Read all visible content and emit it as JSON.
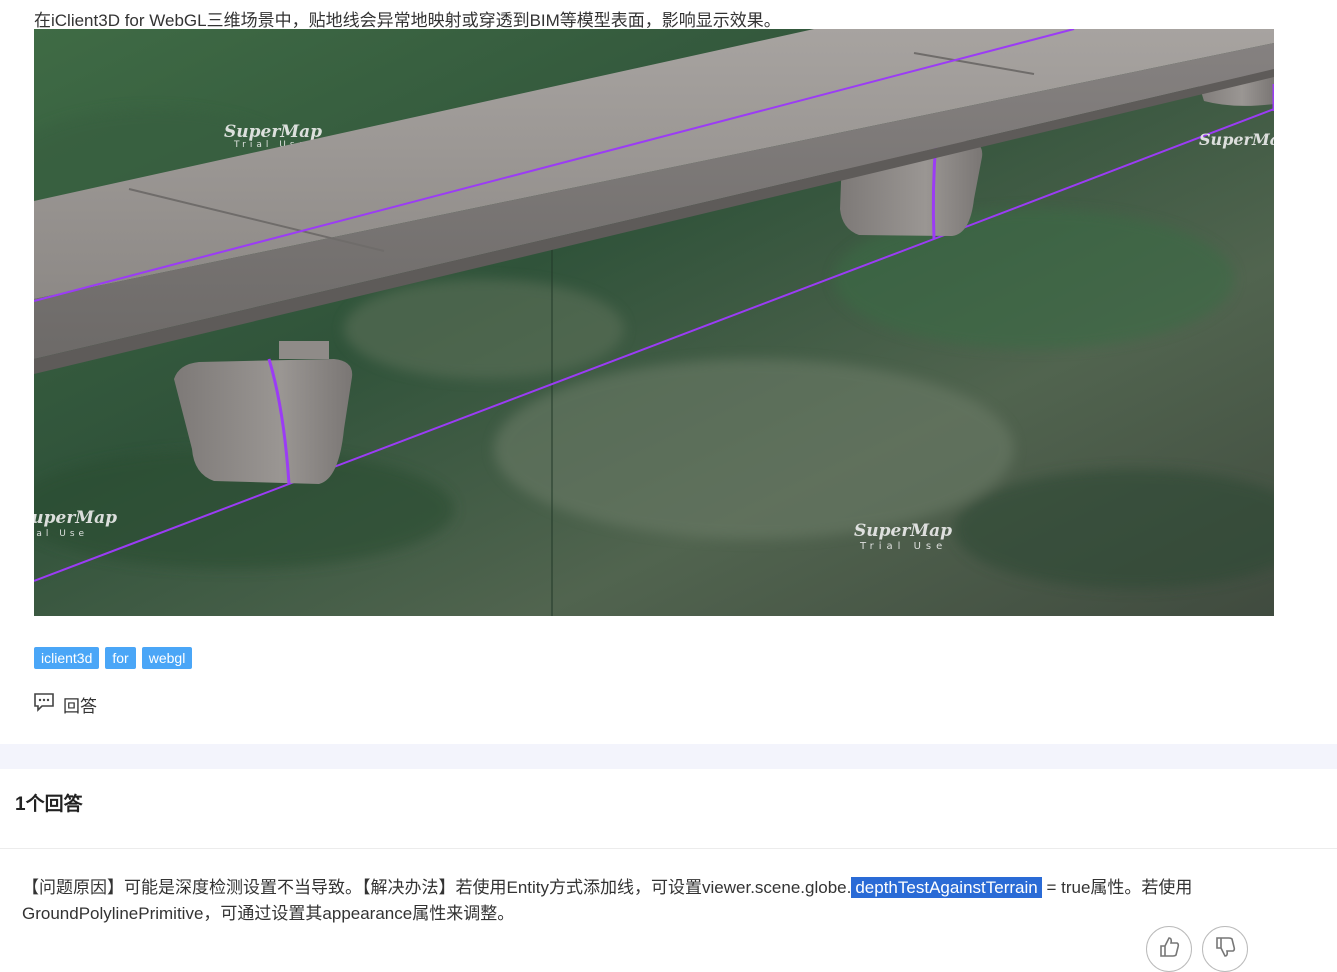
{
  "question": {
    "text": "在iClient3D for WebGL三维场景中，贴地线会异常地映射或穿透到BIM等模型表面，影响显示效果。",
    "scene_watermark": [
      "SuperMap",
      "Trial Use"
    ],
    "tags": [
      "iclient3d",
      "for",
      "webgl"
    ],
    "answer_action_label": "回答"
  },
  "answers": {
    "count_label": "1个回答",
    "items": [
      {
        "text_before": "【问题原因】可能是深度检测设置不当导致。【解决办法】若使用Entity方式添加线，可设置viewer.scene.globe.",
        "text_highlight": "depthTestAgainstTerrain",
        "text_after": " = true属性。若使用GroundPolylinePrimitive，可通过设置其appearance属性来调整。"
      }
    ]
  },
  "colors": {
    "tag_bg": "#4aa6f7",
    "highlight": "#2a6bd6",
    "section_band": "#f3f4fc",
    "polyline": "#9b3cf5"
  },
  "icons": {
    "answer": "comment-icon",
    "upvote": "thumbs-up-icon",
    "downvote": "thumbs-down-icon"
  }
}
